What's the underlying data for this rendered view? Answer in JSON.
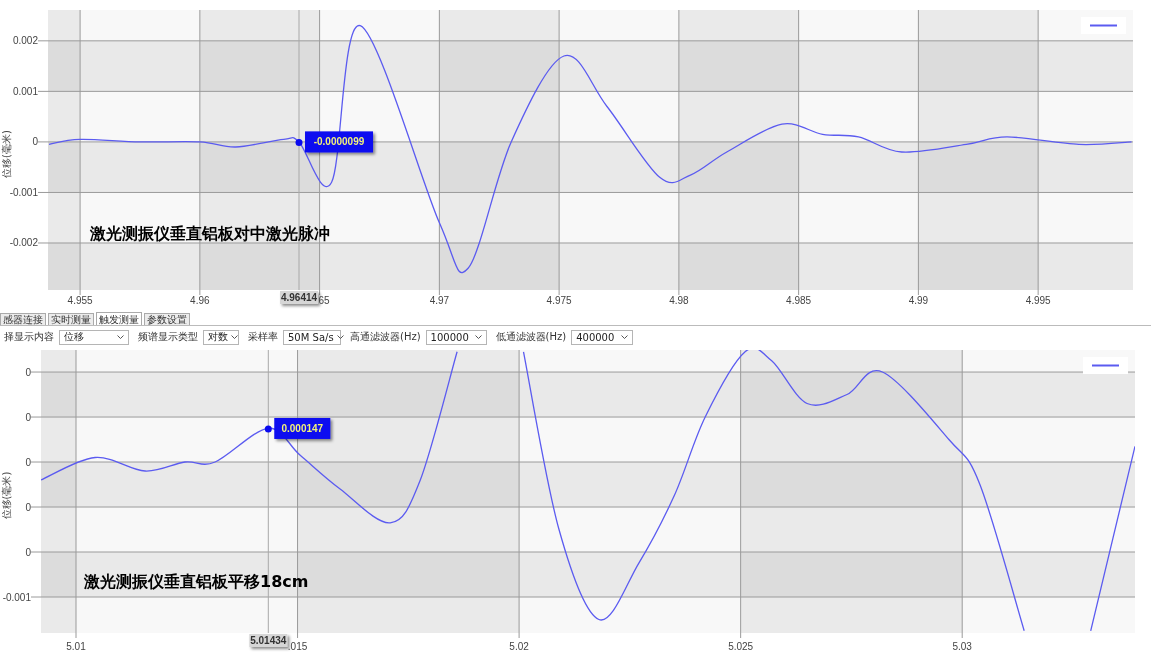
{
  "top_panel": {
    "y_axis_title": "位移(毫米)",
    "caption": "激光测振仪垂直铝板对中激光脉冲",
    "chart_data": {
      "type": "line",
      "grid": true,
      "xlim": [
        4.95366,
        4.99896
      ],
      "ylim": [
        -0.00293,
        0.00261
      ],
      "xticks": [
        4.955,
        4.96,
        4.97,
        4.975,
        4.98,
        4.985,
        4.99,
        4.995
      ],
      "yticks": [
        0.002,
        0.001,
        0,
        -0.001,
        -0.002
      ],
      "x": [
        4.9537,
        4.955,
        4.9575,
        4.96,
        4.9615,
        4.9635,
        4.96414,
        4.9655,
        4.9667,
        4.97,
        4.9712,
        4.973,
        4.9752,
        4.977,
        4.9792,
        4.9805,
        4.982,
        4.9843,
        4.986,
        4.9875,
        4.9893,
        4.992,
        4.9937,
        4.9967,
        4.9989
      ],
      "series": [
        {
          "color": "#5b5bf0",
          "values": [
            -5e-05,
            5e-05,
            0.0,
            0.0,
            -0.0001,
            5e-05,
            0.0,
            -0.0008,
            0.0023,
            -0.0016,
            -0.0025,
            0.0,
            0.0017,
            0.0007,
            -0.0007,
            -0.00065,
            -0.0002,
            0.00035,
            0.00015,
            0.0001,
            -0.0002,
            -5e-05,
            0.0001,
            -5e-05,
            0.0
          ]
        }
      ],
      "bands": [
        {
          "axis": "x",
          "from": 4.95366,
          "to": 4.955
        },
        {
          "axis": "x",
          "from": 4.96,
          "to": 4.965
        },
        {
          "axis": "x",
          "from": 4.97,
          "to": 4.975
        },
        {
          "axis": "x",
          "from": 4.98,
          "to": 4.985
        },
        {
          "axis": "x",
          "from": 4.99,
          "to": 4.995
        }
      ],
      "ref_lines": [
        {
          "axis": "x",
          "value": 4.96414,
          "label": "4.96414"
        }
      ],
      "annotations": [
        {
          "x": 4.96414,
          "y": -9.9e-06,
          "text": "-0.0000099"
        }
      ]
    },
    "covered_tick_label": "65"
  },
  "tabs": [
    {
      "label": "感器连接",
      "selected": false
    },
    {
      "label": "实时测量",
      "selected": false
    },
    {
      "label": "触发测量",
      "selected": true
    },
    {
      "label": "参数设置",
      "selected": false
    }
  ],
  "toolbar": [
    {
      "kind": "label",
      "text": "择显示内容"
    },
    {
      "kind": "dropdown",
      "value": "位移"
    },
    {
      "kind": "label",
      "text": "频谱显示类型"
    },
    {
      "kind": "dropdown",
      "value": "对数"
    },
    {
      "kind": "label",
      "text": "采样率"
    },
    {
      "kind": "dropdown",
      "value": "50M Sa/s"
    },
    {
      "kind": "label",
      "text": "高通滤波器(Hz)"
    },
    {
      "kind": "dropdown",
      "value": "100000"
    },
    {
      "kind": "label",
      "text": "低通滤波器(Hz)"
    },
    {
      "kind": "dropdown",
      "value": "400000"
    }
  ],
  "bottom_panel": {
    "y_axis_title": "位移(毫米)",
    "caption": "激光测振仪垂直铝板平移18cm",
    "chart_data": {
      "type": "line",
      "grid": true,
      "xlim": [
        5.00921,
        5.0339
      ],
      "ylim": [
        -0.00076,
        0.000498
      ],
      "xticks": [
        5.01,
        5.02,
        5.025,
        5.03
      ],
      "yticks": [
        {
          "value": 0.0004,
          "label": "0"
        },
        {
          "value": 0.0002,
          "label": "0"
        },
        {
          "value": 0,
          "label": "0"
        },
        {
          "value": -0.0002,
          "label": "0"
        },
        {
          "value": -0.0004,
          "label": "0"
        },
        {
          "value": -0.0006,
          "label": "-0.001"
        }
      ],
      "x": [
        5.00921,
        5.01043,
        5.01156,
        5.01246,
        5.01314,
        5.01434,
        5.01506,
        5.01596,
        5.01709,
        5.01777,
        5.0186,
        5.0193,
        5.0201,
        5.0209,
        5.0218,
        5.0227,
        5.0235,
        5.0242,
        5.0251,
        5.0257,
        5.0265,
        5.0274,
        5.0282,
        5.0297,
        5.0304,
        5.0314,
        5.0322,
        5.0329,
        5.0339
      ],
      "series": [
        {
          "color": "#5b5bf0",
          "values": [
            -8e-05,
            2e-05,
            -4e-05,
            0.0,
            0.0,
            0.00015,
            3e-05,
            -0.00012,
            -0.00027,
            -8e-05,
            0.00049,
            null,
            0.00049,
            -0.0003,
            -0.0007,
            -0.00045,
            -0.00015,
            0.0002,
            0.00049,
            0.00045,
            0.00026,
            0.0003,
            0.0004,
            0.0001,
            -0.0001,
            -0.00075,
            null,
            -0.00075,
            7e-05
          ]
        }
      ],
      "bands": [
        {
          "axis": "x",
          "from": 5.00921,
          "to": 5.01
        },
        {
          "axis": "x",
          "from": 5.015,
          "to": 5.02
        },
        {
          "axis": "x",
          "from": 5.025,
          "to": 5.03
        }
      ],
      "ref_lines": [
        {
          "axis": "x",
          "value": 5.01434,
          "label": "5.01434"
        }
      ],
      "annotations": [
        {
          "x": 5.01434,
          "y": 0.000147,
          "text": "0.000147"
        }
      ]
    },
    "covered_tick_label": ".015"
  }
}
